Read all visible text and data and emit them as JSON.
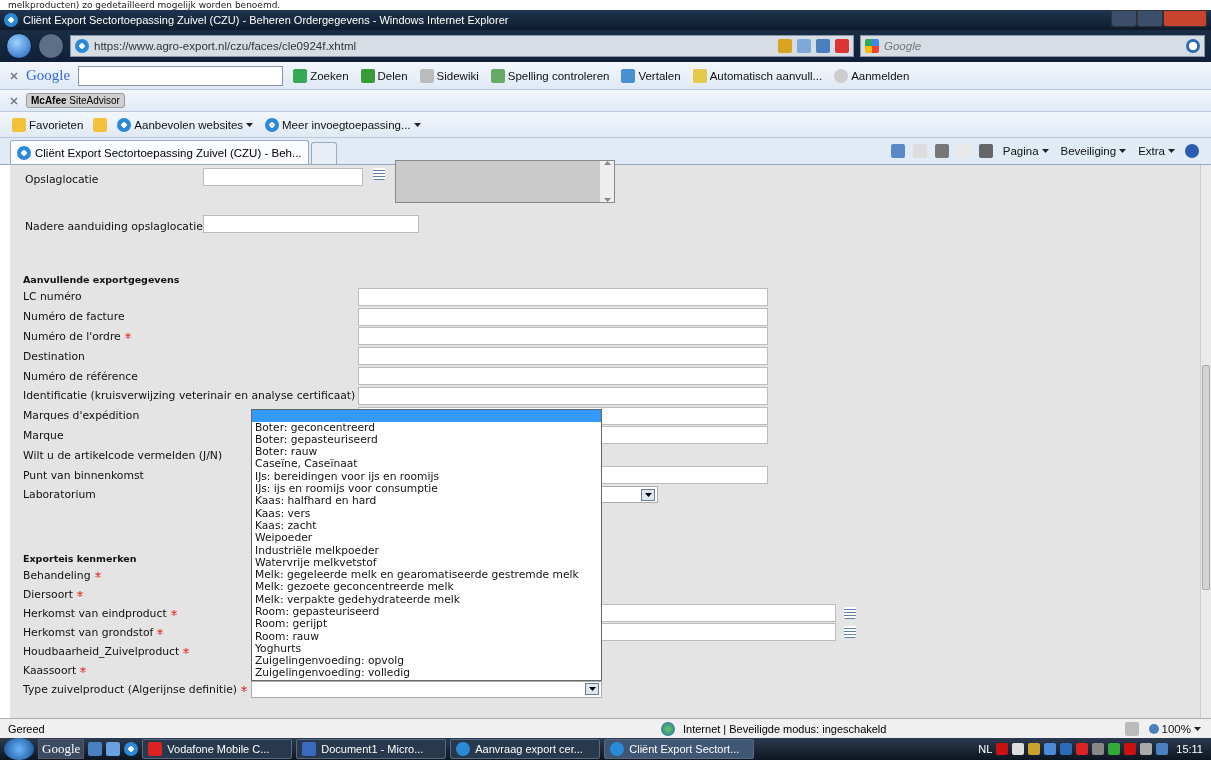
{
  "caption": "melkproducten) zo gedetailleerd mogelijk worden benoemd.",
  "window": {
    "title": "Cliënt Export Sectortoepassing Zuivel (CZU) - Beheren Ordergegevens - Windows Internet Explorer",
    "address": "https://www.agro-export.nl/czu/faces/cle0924f.xhtml",
    "search_placeholder": "Google"
  },
  "google_toolbar": {
    "logo": "Google",
    "items": [
      "Zoeken",
      "Delen",
      "Sidewiki",
      "Spelling controleren",
      "Vertalen",
      "Automatisch aanvull...",
      "Aanmelden"
    ]
  },
  "siteadvisor": {
    "label": "**McAfee** SiteAdvisor"
  },
  "favorites": {
    "label": "Favorieten",
    "links": [
      "Aanbevolen websites",
      "Meer invoegtoepassing..."
    ]
  },
  "tabs": [
    {
      "label": "Cliënt Export Sectortoepassing Zuivel (CZU) - Beh...",
      "selected": true
    }
  ],
  "command_bar": [
    "Pagina",
    "Beveiliging",
    "Extra"
  ],
  "location": [
    {
      "label": "Opslaglocatie",
      "kind": "picker"
    },
    {
      "label": "Nadere aanduiding opslaglocatie",
      "kind": "text"
    }
  ],
  "sections": [
    {
      "title": "Aanvullende exportgegevens",
      "rows": [
        {
          "label": "LC numéro",
          "required": false,
          "kind": "text"
        },
        {
          "label": "Numéro de facture",
          "required": false,
          "kind": "text"
        },
        {
          "label": "Numéro de l'ordre",
          "required": true,
          "kind": "text"
        },
        {
          "label": "Destination",
          "required": false,
          "kind": "text"
        },
        {
          "label": "Numéro de référence",
          "required": false,
          "kind": "text"
        },
        {
          "label": "Identificatie (kruisverwijzing veterinair en analyse certificaat)",
          "required": false,
          "kind": "text"
        },
        {
          "label": "Marques d'expédition",
          "required": false,
          "kind": "text"
        },
        {
          "label": "Marque",
          "required": false,
          "kind": "text"
        },
        {
          "label": "Wilt u de artikelcode vermelden (J/N)",
          "required": false,
          "kind": "none"
        },
        {
          "label": "Punt van binnenkomst",
          "required": false,
          "kind": "text"
        },
        {
          "label": "Laboratorium",
          "required": false,
          "kind": "select"
        }
      ]
    },
    {
      "title": "Exporteis kenmerken",
      "rows": [
        {
          "label": "Behandeling",
          "required": true,
          "kind": "none"
        },
        {
          "label": "Diersoort",
          "required": true,
          "kind": "none"
        },
        {
          "label": "Herkomst van eindproduct",
          "required": true,
          "kind": "date"
        },
        {
          "label": "Herkomst van grondstof",
          "required": true,
          "kind": "date"
        },
        {
          "label": "Houdbaarheid_Zuivelproduct",
          "required": true,
          "kind": "none"
        },
        {
          "label": "Kaassoort",
          "required": true,
          "kind": "none"
        },
        {
          "label": "Type zuivelproduct (Algerijnse definitie)",
          "required": true,
          "kind": "open-select"
        }
      ]
    }
  ],
  "dropdown": {
    "blank_selected": true,
    "options": [
      {
        "label": "Boter: geconcentreerd",
        "selected": false
      },
      {
        "label": "Boter: gepasteuriseerd",
        "selected": false
      },
      {
        "label": "Boter: rauw",
        "selected": false
      },
      {
        "label": "Caseïne, Caseïnaat",
        "selected": false
      },
      {
        "label": "IJs: bereidingen voor ijs en roomijs",
        "selected": false
      },
      {
        "label": "IJs: ijs en roomijs voor consumptie",
        "selected": false
      },
      {
        "label": "Kaas: halfhard en hard",
        "selected": false
      },
      {
        "label": "Kaas: vers",
        "selected": false
      },
      {
        "label": "Kaas: zacht",
        "selected": false
      },
      {
        "label": "Weipoeder",
        "selected": false
      },
      {
        "label": "Industriële melkpoeder",
        "selected": false
      },
      {
        "label": "Watervrije melkvetstof",
        "selected": false
      },
      {
        "label": "Melk: gegeleerde melk en gearomatiseerde gestremde melk",
        "selected": false
      },
      {
        "label": "Melk: gezoete geconcentreerde melk",
        "selected": false
      },
      {
        "label": "Melk: verpakte gedehydrateerde melk",
        "selected": false
      },
      {
        "label": "Room: gepasteuriseerd",
        "selected": false
      },
      {
        "label": "Room: gerijpt",
        "selected": false
      },
      {
        "label": "Room: rauw",
        "selected": false
      },
      {
        "label": "Yoghurts",
        "selected": false
      },
      {
        "label": "Zuigelingenvoeding: opvolg",
        "selected": false
      },
      {
        "label": "Zuigelingenvoeding: volledig",
        "selected": false
      }
    ]
  },
  "status_bar": {
    "text": "Gereed",
    "zone": "Internet | Beveiligde modus: ingeschakeld",
    "zoom": "100%"
  },
  "taskbar": {
    "quicklaunch": "Google",
    "tasks": [
      {
        "label": "Vodafone Mobile C...",
        "selected": false
      },
      {
        "label": "Document1 - Micro...",
        "selected": false
      },
      {
        "label": "Aanvraag export cer...",
        "selected": false
      },
      {
        "label": "Cliënt Export Sectort...",
        "selected": true
      }
    ],
    "language": "NL",
    "clock": "15:11"
  }
}
